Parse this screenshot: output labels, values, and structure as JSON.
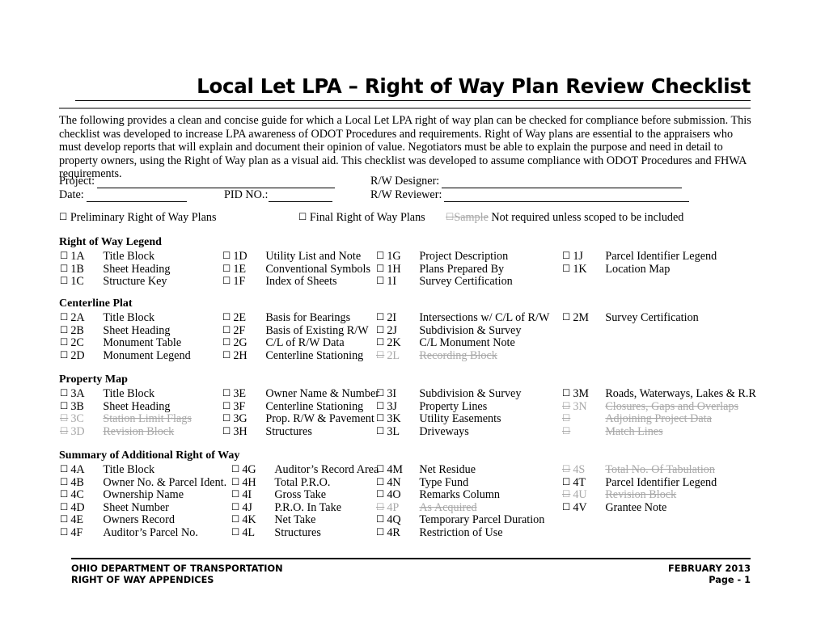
{
  "document": {
    "title": "Local Let LPA – Right of Way Plan Review Checklist",
    "intro": "The following provides a clean and concise guide for which a Local Let LPA right of way plan can be checked for compliance before submission. This checklist was developed to increase LPA awareness of ODOT Procedures and requirements.   Right of Way plans are essential to the appraisers who must develop reports that will explain and document their opinion of value. Negotiators must be able to explain the purpose and need in detail to property owners, using the Right of Way plan as a visual aid.  This checklist was developed to assume compliance with ODOT Procedures and FHWA requirements."
  },
  "form": {
    "project_label": "Project:",
    "project_value": "",
    "date_label": "Date:",
    "date_value": "",
    "pid_label": "PID NO.:",
    "pid_value": "",
    "designer_label": "R/W Designer:",
    "designer_value": "",
    "reviewer_label": "R/W Reviewer:",
    "reviewer_value": ""
  },
  "plan_type_options": {
    "checkbox_glyph": "☐",
    "preliminary": "Preliminary Right of Way Plans",
    "final": "Final Right of Way Plans",
    "sample": "Sample",
    "sample_note": "Not required unless scoped to be included"
  },
  "checkbox_glyph": "☐",
  "sections": [
    {
      "title": "Right of Way Legend",
      "columns": [
        [
          {
            "code": "1A",
            "label": "Title Block",
            "struck": false
          },
          {
            "code": "1B",
            "label": "Sheet Heading",
            "struck": false
          },
          {
            "code": "1C",
            "label": "Structure Key",
            "struck": false
          }
        ],
        [
          {
            "code": "1D",
            "label": "Utility List and Note",
            "struck": false
          },
          {
            "code": "1E",
            "label": "Conventional Symbols",
            "struck": false
          },
          {
            "code": "1F",
            "label": "Index of Sheets",
            "struck": false
          }
        ],
        [
          {
            "code": "1G",
            "label": "Project Description",
            "struck": false
          },
          {
            "code": "1H",
            "label": "Plans Prepared By",
            "struck": false
          },
          {
            "code": "1I",
            "label": "Survey Certification",
            "struck": false
          }
        ],
        [
          {
            "code": "1J",
            "label": "Parcel Identifier Legend",
            "struck": false
          },
          {
            "code": "1K",
            "label": "Location Map",
            "struck": false
          }
        ]
      ]
    },
    {
      "title": "Centerline Plat",
      "columns": [
        [
          {
            "code": "2A",
            "label": "Title Block",
            "struck": false
          },
          {
            "code": "2B",
            "label": "Sheet Heading",
            "struck": false
          },
          {
            "code": "2C",
            "label": "Monument Table",
            "struck": false
          },
          {
            "code": "2D",
            "label": "Monument Legend",
            "struck": false
          }
        ],
        [
          {
            "code": "2E",
            "label": "Basis for Bearings",
            "struck": false
          },
          {
            "code": "2F",
            "label": "Basis of Existing R/W",
            "struck": false
          },
          {
            "code": "2G",
            "label": "C/L of R/W Data",
            "struck": false
          },
          {
            "code": "2H",
            "label": "Centerline Stationing",
            "struck": false
          }
        ],
        [
          {
            "code": "2I",
            "label": "Intersections w/ C/L of R/W",
            "struck": false
          },
          {
            "code": "2J",
            "label": "Subdivision & Survey",
            "struck": false
          },
          {
            "code": "2K",
            "label": "C/L Monument Note",
            "struck": false
          },
          {
            "code": "2L",
            "label": "Recording Block",
            "struck": true
          }
        ],
        [
          {
            "code": "2M",
            "label": "Survey Certification",
            "struck": false
          }
        ]
      ]
    },
    {
      "title": "Property Map",
      "columns": [
        [
          {
            "code": "3A",
            "label": "Title Block",
            "struck": false
          },
          {
            "code": "3B",
            "label": "Sheet Heading",
            "struck": false
          },
          {
            "code": "3C",
            "label": "Station Limit Flags",
            "struck": true
          },
          {
            "code": "3D",
            "label": "Revision Block",
            "struck": true
          }
        ],
        [
          {
            "code": "3E",
            "label": "Owner Name & Number",
            "struck": false
          },
          {
            "code": "3F",
            "label": "Centerline Stationing",
            "struck": false
          },
          {
            "code": "3G",
            "label": "Prop. R/W & Pavement",
            "struck": false
          },
          {
            "code": "3H",
            "label": "Structures",
            "struck": false
          }
        ],
        [
          {
            "code": "3I",
            "label": "Subdivision & Survey",
            "struck": false
          },
          {
            "code": "3J",
            "label": "Property Lines",
            "struck": false
          },
          {
            "code": "3K",
            "label": "Utility Easements",
            "struck": false
          },
          {
            "code": "3L",
            "label": "Driveways",
            "struck": false
          }
        ],
        [
          {
            "code": "3M",
            "label": "Roads, Waterways, Lakes & R.R",
            "struck": false
          },
          {
            "code": "3N",
            "label": "Closures, Gaps and Overlaps",
            "struck": true
          },
          {
            "code": "",
            "label": "Adjoining Project Data",
            "struck": true
          },
          {
            "code": "",
            "label": "Match Lines",
            "struck": true
          }
        ]
      ]
    },
    {
      "title": "Summary of Additional Right of Way",
      "columns": [
        [
          {
            "code": "4A",
            "label": "Title Block",
            "struck": false
          },
          {
            "code": "4B",
            "label": "Owner No. & Parcel Ident.",
            "struck": false
          },
          {
            "code": "4C",
            "label": "Ownership Name",
            "struck": false
          },
          {
            "code": "4D",
            "label": "Sheet Number",
            "struck": false
          },
          {
            "code": "4E",
            "label": "Owners Record",
            "struck": false
          },
          {
            "code": "4F",
            "label": "Auditor’s Parcel No.",
            "struck": false
          }
        ],
        [
          {
            "code": "4G",
            "label": "Auditor’s Record Area",
            "struck": false
          },
          {
            "code": "4H",
            "label": "Total P.R.O.",
            "struck": false
          },
          {
            "code": "4I",
            "label": "Gross Take",
            "struck": false
          },
          {
            "code": "4J",
            "label": "P.R.O. In Take",
            "struck": false
          },
          {
            "code": "4K",
            "label": "Net Take",
            "struck": false
          },
          {
            "code": "4L",
            "label": "Structures",
            "struck": false
          }
        ],
        [
          {
            "code": "4M",
            "label": "Net Residue",
            "struck": false
          },
          {
            "code": "4N",
            "label": "Type Fund",
            "struck": false
          },
          {
            "code": "4O",
            "label": "Remarks Column",
            "struck": false
          },
          {
            "code": "4P",
            "label": "As Acquired",
            "struck": true
          },
          {
            "code": "4Q",
            "label": "Temporary Parcel Duration",
            "struck": false
          },
          {
            "code": "4R",
            "label": "Restriction of Use",
            "struck": false
          }
        ],
        [
          {
            "code": "4S",
            "label": "Total No. Of Tabulation",
            "struck": true
          },
          {
            "code": "4T",
            "label": "Parcel Identifier Legend",
            "struck": false
          },
          {
            "code": "4U",
            "label": "Revision Block",
            "struck": true
          },
          {
            "code": "4V",
            "label": "Grantee Note",
            "struck": false
          }
        ]
      ]
    }
  ],
  "footer": {
    "left_line1": "OHIO DEPARTMENT OF TRANSPORTATION",
    "left_line2": "RIGHT OF WAY APPENDICES",
    "right_line1": "FEBRUARY 2013",
    "right_line2": "Page - 1"
  }
}
